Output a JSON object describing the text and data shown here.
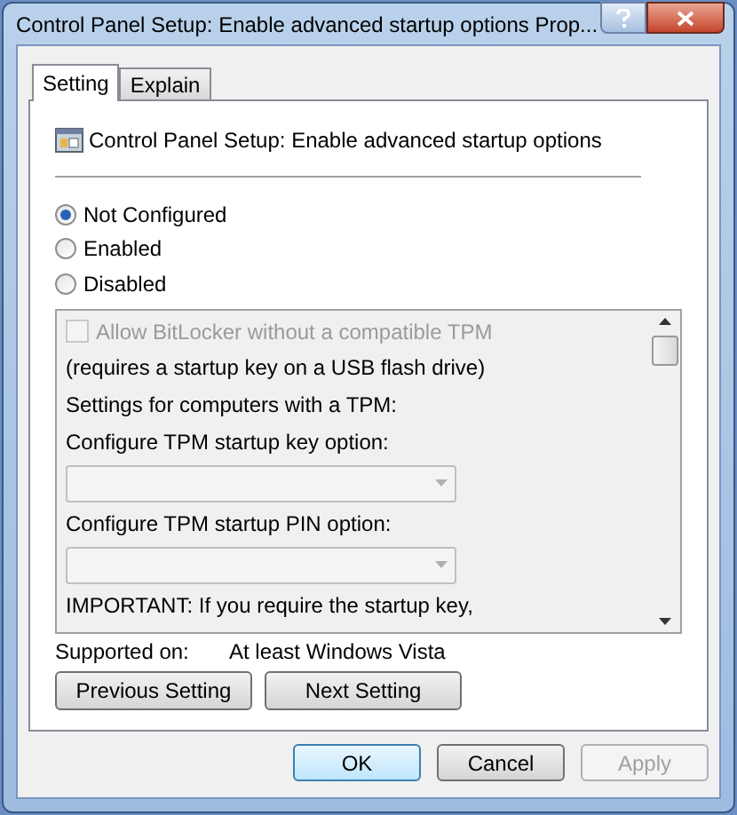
{
  "window": {
    "title": "Control Panel Setup: Enable advanced startup options Prop..."
  },
  "tabs": [
    {
      "label": "Setting",
      "selected": true
    },
    {
      "label": "Explain",
      "selected": false
    }
  ],
  "policy": {
    "title": "Control Panel Setup: Enable advanced startup options"
  },
  "options": [
    {
      "label": "Not Configured",
      "selected": true
    },
    {
      "label": "Enabled",
      "selected": false
    },
    {
      "label": "Disabled",
      "selected": false
    }
  ],
  "settings": [
    {
      "kind": "checkbox",
      "label": "Allow BitLocker without a compatible TPM",
      "checked": false,
      "disabled": true
    },
    {
      "kind": "text",
      "label": "(requires a startup key on a USB flash drive)"
    },
    {
      "kind": "text",
      "label": "Settings for computers with a TPM:"
    },
    {
      "kind": "text",
      "label": "Configure TPM startup key option:"
    },
    {
      "kind": "dropdown",
      "disabled": true
    },
    {
      "kind": "text",
      "label": "Configure TPM startup PIN option:"
    },
    {
      "kind": "dropdown",
      "disabled": true
    },
    {
      "kind": "text",
      "label": "IMPORTANT: If you require the startup key,"
    }
  ],
  "supported": {
    "label": "Supported on:",
    "value": "At least Windows Vista"
  },
  "nav_buttons": [
    {
      "label": "Previous Setting"
    },
    {
      "label": "Next Setting"
    }
  ],
  "buttons": [
    {
      "label": "OK",
      "disabled": false,
      "default": true
    },
    {
      "label": "Cancel",
      "disabled": false,
      "default": false
    },
    {
      "label": "Apply",
      "disabled": true,
      "default": false
    }
  ]
}
